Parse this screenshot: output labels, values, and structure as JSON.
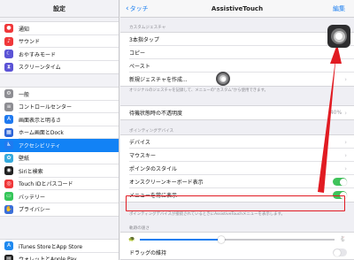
{
  "sidebar": {
    "title": "設定",
    "group1": [
      {
        "label": "通知",
        "icon": "bell-icon",
        "color": "#f0383a",
        "glyph": "●"
      },
      {
        "label": "サウンド",
        "icon": "speaker-icon",
        "color": "#f0383a",
        "glyph": "♪"
      },
      {
        "label": "おやすみモード",
        "icon": "moon-icon",
        "color": "#5b53d6",
        "glyph": "☾"
      },
      {
        "label": "スクリーンタイム",
        "icon": "hourglass-icon",
        "color": "#5b53d6",
        "glyph": "⧗"
      }
    ],
    "group2": [
      {
        "label": "一般",
        "icon": "gear-icon",
        "color": "#8e8e93",
        "glyph": "⚙"
      },
      {
        "label": "コントロールセンター",
        "icon": "toggles-icon",
        "color": "#8e8e93",
        "glyph": "≡"
      },
      {
        "label": "画面表示と明るさ",
        "icon": "text-size-icon",
        "color": "#1f7af0",
        "glyph": "A"
      },
      {
        "label": "ホーム画面とDock",
        "icon": "grid-icon",
        "color": "#2d65d8",
        "glyph": "▦"
      },
      {
        "label": "アクセシビリティ",
        "icon": "accessibility-icon",
        "color": "#1f7af0",
        "glyph": "♿",
        "selected": true
      },
      {
        "label": "壁紙",
        "icon": "flower-icon",
        "color": "#35aadc",
        "glyph": "✿"
      },
      {
        "label": "Siriと検索",
        "icon": "siri-icon",
        "color": "#222",
        "glyph": "◉"
      },
      {
        "label": "Touch IDとパスコード",
        "icon": "fingerprint-icon",
        "color": "#f0383a",
        "glyph": "◎"
      },
      {
        "label": "バッテリー",
        "icon": "battery-icon",
        "color": "#35c659",
        "glyph": "▭"
      },
      {
        "label": "プライバシー",
        "icon": "hand-icon",
        "color": "#3b6fd8",
        "glyph": "✋"
      }
    ],
    "group3": [
      {
        "label": "iTunes StoreとApp Store",
        "icon": "app-store-icon",
        "color": "#1f8af0",
        "glyph": "A"
      },
      {
        "label": "ウォレットとApple Pay",
        "icon": "wallet-icon",
        "color": "#222",
        "glyph": "▤"
      }
    ]
  },
  "nav": {
    "back_label": "タッチ",
    "title": "AssistiveTouch",
    "edit_label": "編集"
  },
  "custom_gestures": {
    "header": "カスタムジェスチャ",
    "rows": [
      "3本指タップ",
      "コピー",
      "ペースト",
      "新規ジェスチャを作成..."
    ],
    "footer": "オリジナルのジェスチャを記録して、メニューの\"カスタム\"から使用できます。"
  },
  "idle_opacity": {
    "label": "待機状態時の不透明度",
    "value": "40%"
  },
  "pointing": {
    "header": "ポインティングデバイス",
    "rows": [
      {
        "label": "デバイス",
        "type": "chevron"
      },
      {
        "label": "マウスキー",
        "type": "chevron"
      },
      {
        "label": "ポインタのスタイル",
        "type": "chevron"
      },
      {
        "label": "オンスクリーンキーボード表示",
        "type": "toggle",
        "on": true
      },
      {
        "label": "メニューを常に表示",
        "type": "toggle",
        "on": true
      }
    ],
    "footer": "ポインティングデバイスが接続されているときにAssistiveTouchメニューを表示します。"
  },
  "tracking": {
    "header": "軌跡の速さ",
    "slider_fraction": 0.42,
    "turtle_icon": "turtle-icon",
    "hare_icon": "hare-icon"
  },
  "drag_lock": {
    "label": "ドラッグの維持",
    "on": false
  },
  "colors": {
    "accent": "#1a7ef0",
    "toggle_on": "#3fc35a",
    "highlight": "#e11b22"
  }
}
